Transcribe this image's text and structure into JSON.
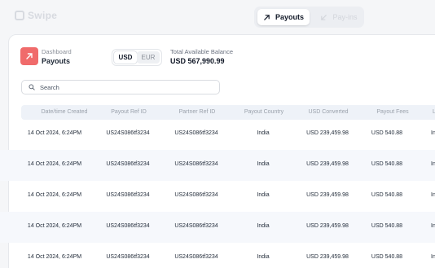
{
  "topbar": {
    "logo_text": "Swipe",
    "tabs": [
      {
        "label": "Payouts",
        "icon": "arrow-up-right-icon",
        "active": true
      },
      {
        "label": "Pay-ins",
        "icon": "arrow-down-left-icon",
        "active": false
      }
    ]
  },
  "page": {
    "breadcrumb": "Dashboard",
    "title": "Payouts",
    "icon": "arrow-up-right-icon",
    "accent_color": "#f06b6b"
  },
  "currency": {
    "options": [
      "USD",
      "EUR"
    ],
    "selected": "USD"
  },
  "balance": {
    "label": "Total Available Balance",
    "value": "USD 567,990.99"
  },
  "search": {
    "placeholder": "Search",
    "value": ""
  },
  "table": {
    "columns": [
      "Date/time Created",
      "Payout Ref ID",
      "Partner Ref ID",
      "Payout Country",
      "USD Converted",
      "Payout Fees",
      "La"
    ],
    "rows": [
      {
        "date": "14 Oct 2024, 6:24PM",
        "payout_ref": "US24S086tf3234",
        "partner_ref": "US24S086tf3234",
        "country": "India",
        "usd": "USD 239,459.98",
        "fees": "USD 540.88",
        "last": "In"
      },
      {
        "date": "14 Oct 2024, 6:24PM",
        "payout_ref": "US24S086tf3234",
        "partner_ref": "US24S086tf3234",
        "country": "India",
        "usd": "USD 239,459.98",
        "fees": "USD 540.88",
        "last": "In"
      },
      {
        "date": "14 Oct 2024, 6:24PM",
        "payout_ref": "US24S086tf3234",
        "partner_ref": "US24S086tf3234",
        "country": "India",
        "usd": "USD 239,459.98",
        "fees": "USD 540.88",
        "last": "In"
      },
      {
        "date": "14 Oct 2024, 6:24PM",
        "payout_ref": "US24S086tf3234",
        "partner_ref": "US24S086tf3234",
        "country": "India",
        "usd": "USD 239,459.98",
        "fees": "USD 540.88",
        "last": "In"
      },
      {
        "date": "14 Oct 2024, 6:24PM",
        "payout_ref": "US24S086tf3234",
        "partner_ref": "US24S086tf3234",
        "country": "India",
        "usd": "USD 239,459.98",
        "fees": "USD 540.88",
        "last": "In"
      }
    ]
  }
}
